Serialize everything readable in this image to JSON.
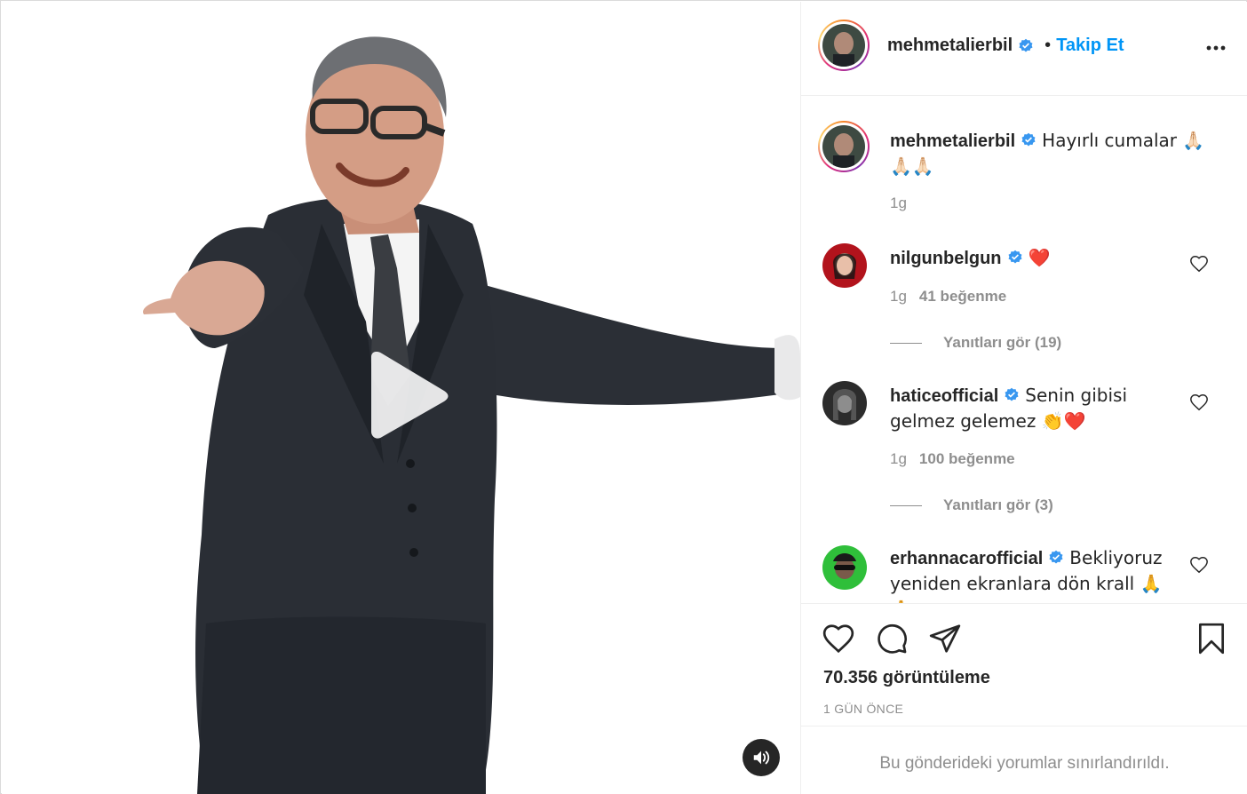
{
  "post": {
    "author": "mehmetalierbil",
    "follow_label": "Takip Et",
    "separator": "•"
  },
  "caption": {
    "username": "mehmetalierbil",
    "text": "Hayırlı cumalar 🙏🏻🙏🏻🙏🏻",
    "time": "1g"
  },
  "comments": [
    {
      "username": "nilgunbelgun",
      "text": "❤️",
      "time": "1g",
      "likes": "41 beğenme",
      "replies": "Yanıtları gör (19)"
    },
    {
      "username": "haticeofficial",
      "text": "Senin gibisi gelmez gelemez 👏❤️",
      "time": "1g",
      "likes": "100 beğenme",
      "replies": "Yanıtları gör (3)"
    },
    {
      "username": "erhannacarofficial",
      "text": "Bekliyoruz yeniden ekranlara dön krall 🙏🙏",
      "time": "",
      "likes": "",
      "replies": ""
    }
  ],
  "stats": {
    "views": "70.356 görüntüleme",
    "posted": "1 GÜN ÖNCE"
  },
  "footer": {
    "restricted_text": "Bu gönderideki yorumlar sınırlandırıldı."
  },
  "colors": {
    "accent": "#0095f6",
    "verified": "#3897f0",
    "muted": "#8e8e8e",
    "text": "#262626",
    "heart": "#e8202f"
  },
  "icons": [
    "more-icon",
    "verified-icon",
    "heart-icon",
    "comment-icon",
    "share-icon",
    "bookmark-icon",
    "play-icon",
    "speaker-icon"
  ]
}
